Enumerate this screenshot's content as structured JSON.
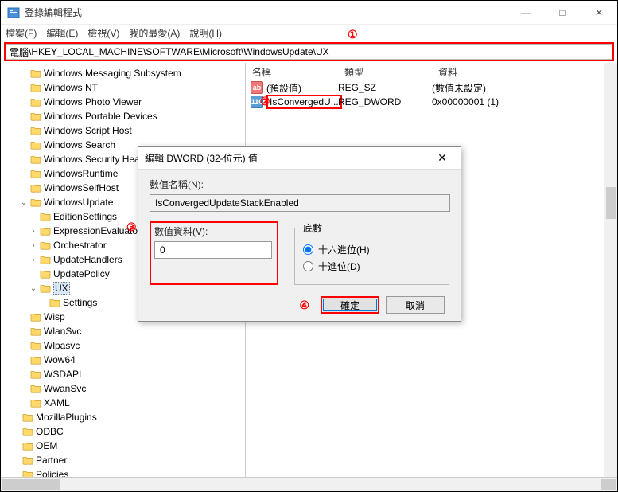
{
  "window": {
    "title": "登錄編輯程式",
    "min": "—",
    "max": "□",
    "close": "✕"
  },
  "menu": {
    "file": "檔案(F)",
    "edit": "編輯(E)",
    "view": "檢視(V)",
    "fav": "我的最愛(A)",
    "help": "說明(H)"
  },
  "address": {
    "prefix": "電腦",
    "path": "\\HKEY_LOCAL_MACHINE\\SOFTWARE\\Microsoft\\WindowsUpdate\\UX"
  },
  "callouts": {
    "one": "①",
    "two": "②",
    "three": "③",
    "four": "④"
  },
  "tree": [
    {
      "lvl": 1,
      "exp": "",
      "name": "Windows Messaging Subsystem"
    },
    {
      "lvl": 1,
      "exp": "",
      "name": "Windows NT"
    },
    {
      "lvl": 1,
      "exp": "",
      "name": "Windows Photo Viewer"
    },
    {
      "lvl": 1,
      "exp": "",
      "name": "Windows Portable Devices"
    },
    {
      "lvl": 1,
      "exp": "",
      "name": "Windows Script Host"
    },
    {
      "lvl": 1,
      "exp": "",
      "name": "Windows Search"
    },
    {
      "lvl": 1,
      "exp": "",
      "name": "Windows Security Heal"
    },
    {
      "lvl": 1,
      "exp": "",
      "name": "WindowsRuntime"
    },
    {
      "lvl": 1,
      "exp": "",
      "name": "WindowsSelfHost"
    },
    {
      "lvl": 1,
      "exp": "v",
      "name": "WindowsUpdate"
    },
    {
      "lvl": 2,
      "exp": "",
      "name": "EditionSettings"
    },
    {
      "lvl": 2,
      "exp": ">",
      "name": "ExpressionEvaluator"
    },
    {
      "lvl": 2,
      "exp": ">",
      "name": "Orchestrator"
    },
    {
      "lvl": 2,
      "exp": ">",
      "name": "UpdateHandlers"
    },
    {
      "lvl": 2,
      "exp": "",
      "name": "UpdatePolicy"
    },
    {
      "lvl": 2,
      "exp": "v",
      "name": "UX",
      "sel": true
    },
    {
      "lvl": 3,
      "exp": "",
      "name": "Settings"
    },
    {
      "lvl": 1,
      "exp": "",
      "name": "Wisp"
    },
    {
      "lvl": 1,
      "exp": "",
      "name": "WlanSvc"
    },
    {
      "lvl": 1,
      "exp": "",
      "name": "Wlpasvc"
    },
    {
      "lvl": 1,
      "exp": "",
      "name": "Wow64"
    },
    {
      "lvl": 1,
      "exp": "",
      "name": "WSDAPI"
    },
    {
      "lvl": 1,
      "exp": "",
      "name": "WwanSvc"
    },
    {
      "lvl": 1,
      "exp": "",
      "name": "XAML"
    },
    {
      "lvl": 0,
      "exp": "",
      "name": "MozillaPlugins"
    },
    {
      "lvl": 0,
      "exp": "",
      "name": "ODBC"
    },
    {
      "lvl": 0,
      "exp": "",
      "name": "OEM"
    },
    {
      "lvl": 0,
      "exp": "",
      "name": "Partner"
    },
    {
      "lvl": 0,
      "exp": "",
      "name": "Policies"
    }
  ],
  "listHeader": {
    "name": "名稱",
    "type": "類型",
    "data": "資料"
  },
  "listRows": [
    {
      "icon": "sz",
      "iconText": "ab",
      "name": "(預設值)",
      "type": "REG_SZ",
      "data": "(數值未設定)"
    },
    {
      "icon": "dw",
      "iconText": "110",
      "name": "IsConvergedU...",
      "type": "REG_DWORD",
      "data": "0x00000001 (1)",
      "hl": true
    }
  ],
  "dialog": {
    "title": "編輯 DWORD (32-位元) 值",
    "nameLabel": "數值名稱(N):",
    "nameValue": "IsConvergedUpdateStackEnabled",
    "valueLabel": "數值資料(V):",
    "valueValue": "0",
    "baseLabel": "底數",
    "hex": "十六進位(H)",
    "dec": "十進位(D)",
    "ok": "確定",
    "cancel": "取消",
    "close": "✕"
  }
}
